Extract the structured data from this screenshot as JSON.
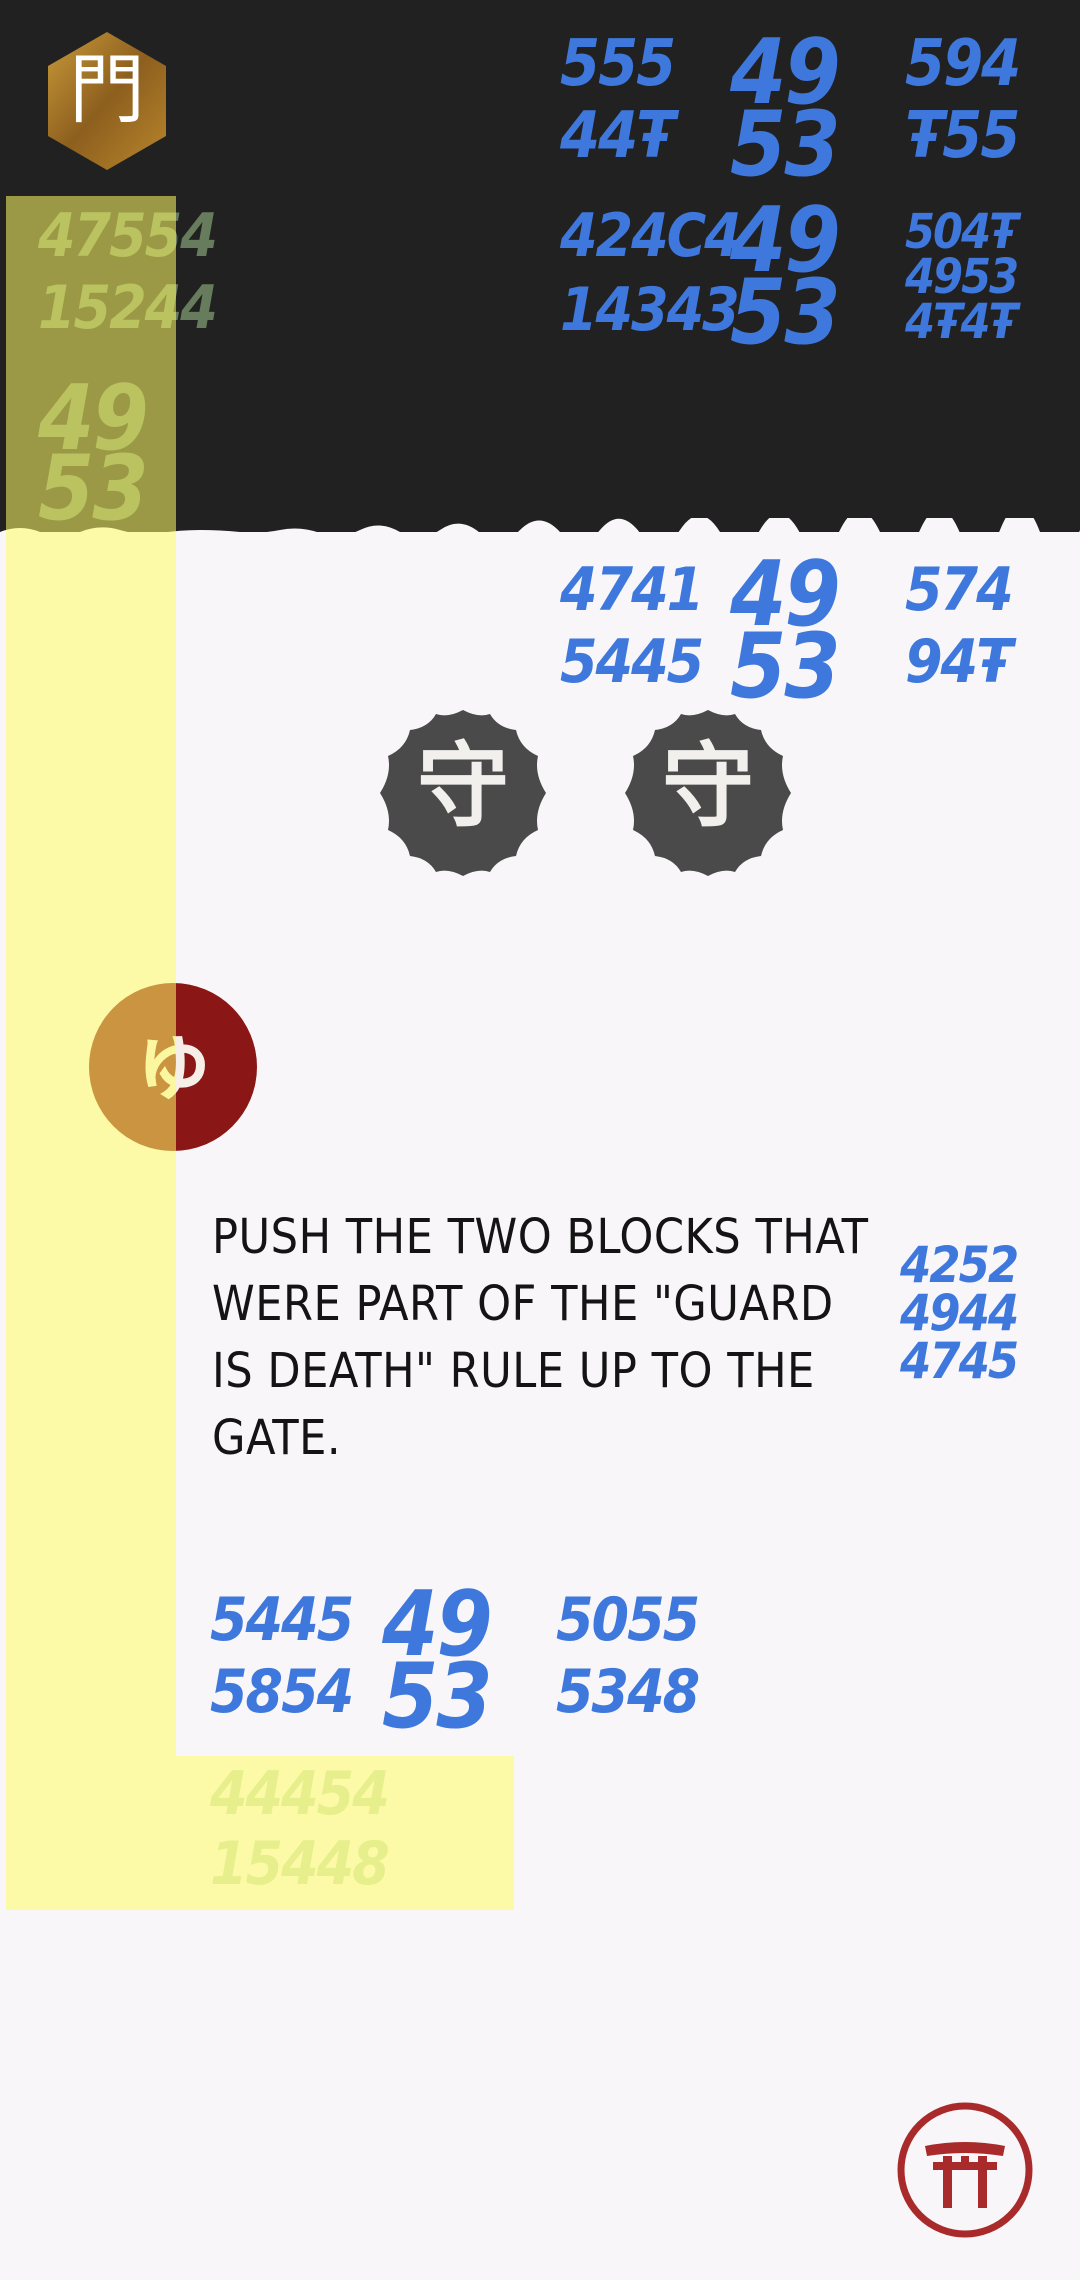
{
  "level_icon": {
    "glyph": "門"
  },
  "status_glyphs": {
    "row1": [
      "555",
      "49",
      "594",
      "44Ŧ",
      "53",
      "Ŧ55"
    ],
    "row2": [
      "424C4",
      "14343",
      "49",
      "53",
      "504Ŧ",
      "4953",
      "4Ŧ4Ŧ"
    ],
    "faded_left": [
      "47554",
      "15244",
      "49",
      "53"
    ],
    "row3": [
      "4741",
      "5445",
      "49",
      "53",
      "574",
      "94Ŧ"
    ],
    "side_note": [
      "4252",
      "4944",
      "4745"
    ],
    "row4": [
      "5445",
      "5854",
      "49",
      "53",
      "5055",
      "5348"
    ],
    "faded_bottom": [
      "44454",
      "15448"
    ]
  },
  "guard_tiles": [
    {
      "glyph": "守"
    },
    {
      "glyph": "守"
    }
  ],
  "death_tile": {
    "glyph": "ゅ"
  },
  "instruction": "PUSH THE TWO BLOCKS THAT WERE PART OF THE \"GUARD IS DEATH\" RULE UP TO THE GATE.",
  "torii_button": {
    "icon": "torii-gate-icon"
  },
  "colors": {
    "dark_band": "#222122",
    "paper": "#f8f6f8",
    "ink_blue": "#3f78dd",
    "highlight": "#fffd64",
    "torii_red": "#a82a2a",
    "guard_grey": "#4a4a4a",
    "death_red": "#8a1616"
  }
}
